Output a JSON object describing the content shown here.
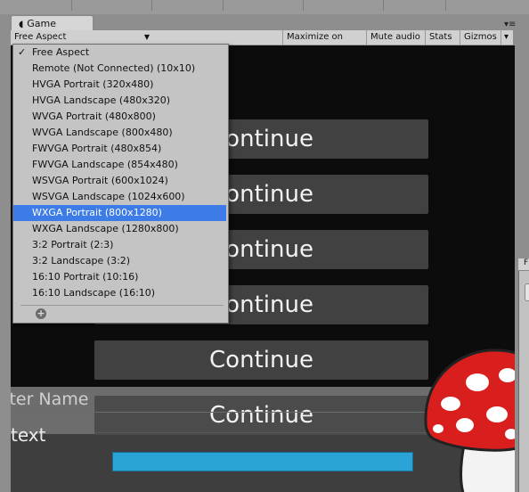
{
  "window": {
    "tab_label": "Game",
    "tab_icon": "game-tab-icon",
    "tab_menu": "▾≡"
  },
  "toolbar": {
    "aspect_label": "Free Aspect",
    "maximize_label": "Maximize on Play",
    "mute_label": "Mute audio",
    "stats_label": "Stats",
    "gizmos_label": "Gizmos",
    "gizmos_arrow": "▾"
  },
  "aspect_menu": {
    "items": [
      {
        "label": "Free Aspect",
        "checked": true
      },
      {
        "label": "Remote (Not Connected) (10x10)"
      },
      {
        "label": "HVGA Portrait (320x480)"
      },
      {
        "label": "HVGA Landscape (480x320)"
      },
      {
        "label": "WVGA Portrait (480x800)"
      },
      {
        "label": "WVGA Landscape (800x480)"
      },
      {
        "label": "FWVGA Portrait (480x854)"
      },
      {
        "label": "FWVGA Landscape (854x480)"
      },
      {
        "label": "WSVGA Portrait (600x1024)"
      },
      {
        "label": "WSVGA Landscape (1024x600)"
      },
      {
        "label": "WXGA Portrait (800x1280)",
        "selected": true
      },
      {
        "label": "WXGA Landscape (1280x800)"
      },
      {
        "label": "3:2 Portrait (2:3)"
      },
      {
        "label": "3:2 Landscape (3:2)"
      },
      {
        "label": "16:10 Portrait (10:16)"
      },
      {
        "label": "16:10 Landscape (16:10)"
      }
    ],
    "add_glyph": "+",
    "check_glyph": "✓"
  },
  "game": {
    "buttons": [
      "Continue",
      "Continue",
      "Continue",
      "Continue",
      "Continue",
      "Continue"
    ],
    "char_name_label": "cter Name",
    "text_label": "text",
    "progress": 1.0,
    "progress_color": "#2aa3d6"
  },
  "right_panel": {
    "header_fragment": "F"
  }
}
